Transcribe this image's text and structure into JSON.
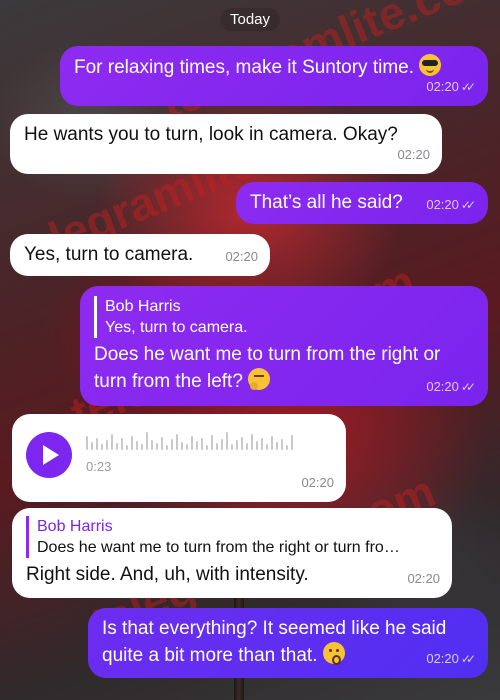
{
  "date_label": "Today",
  "watermark": "telegramlite.com",
  "messages": {
    "m1": {
      "text": "For relaxing times, make it Suntory time.",
      "emoji": "smiling-face-with-sunglasses",
      "time": "02:20"
    },
    "m2": {
      "text": "He wants you to turn, look in camera. Okay?",
      "time": "02:20"
    },
    "m3": {
      "text": "That’s all he said?",
      "time": "02:20"
    },
    "m4": {
      "text": "Yes, turn to camera.",
      "time": "02:20"
    },
    "m5": {
      "reply_name": "Bob Harris",
      "reply_text": "Yes, turn to camera.",
      "text": "Does he want me to turn from the right or turn from the left?",
      "emoji": "thinking-face",
      "time": "02:20"
    },
    "m6": {
      "duration": "0:23",
      "time": "02:20"
    },
    "m7": {
      "reply_name": "Bob Harris",
      "reply_text": "Does he want me to turn from the right or turn fro…",
      "text": "Right side. And, uh, with intensity.",
      "time": "02:20"
    },
    "m8": {
      "text": "Is that everything? It seemed like he said quite a bit more than that.",
      "emoji": "hushed-face",
      "time": "02:20"
    }
  }
}
